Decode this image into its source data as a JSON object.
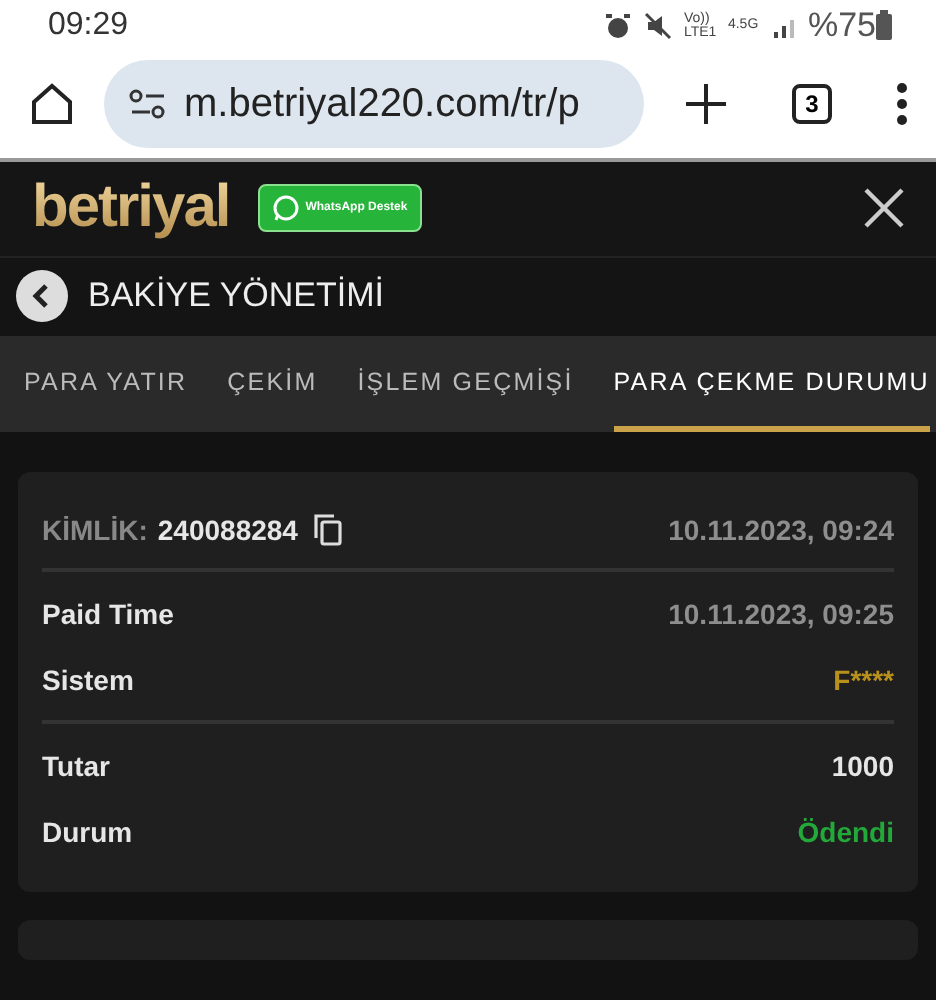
{
  "status_bar": {
    "time": "09:29",
    "network": "Vo)) LTE1",
    "network_2": "4.5G",
    "battery": "%75"
  },
  "browser": {
    "url": "m.betriyal220.com/tr/p",
    "tab_count": "3"
  },
  "header": {
    "logo": "betriyal",
    "support_button": "WhatsApp Destek"
  },
  "page_title": "BAKİYE YÖNETİMİ",
  "tabs": [
    {
      "label": "PARA YATIR",
      "selected": false
    },
    {
      "label": "ÇEKİM",
      "selected": false
    },
    {
      "label": "İŞLEM GEÇMİŞİ",
      "selected": false
    },
    {
      "label": "PARA ÇEKME DURUMU",
      "selected": true
    }
  ],
  "transaction": {
    "id_label": "KİMLİK:",
    "id_value": "240088284",
    "date": "10.11.2023, 09:24",
    "groups": [
      [
        {
          "label": "Paid Time",
          "value": "10.11.2023, 09:25",
          "color": "#8e8e8e"
        },
        {
          "label": "Sistem",
          "value": "F****",
          "color": "#b8901c"
        }
      ],
      [
        {
          "label": "Tutar",
          "value": "1000",
          "color": "#e6e6e6"
        },
        {
          "label": "Durum",
          "value": "Ödendi",
          "color": "#23a83a"
        }
      ]
    ]
  }
}
